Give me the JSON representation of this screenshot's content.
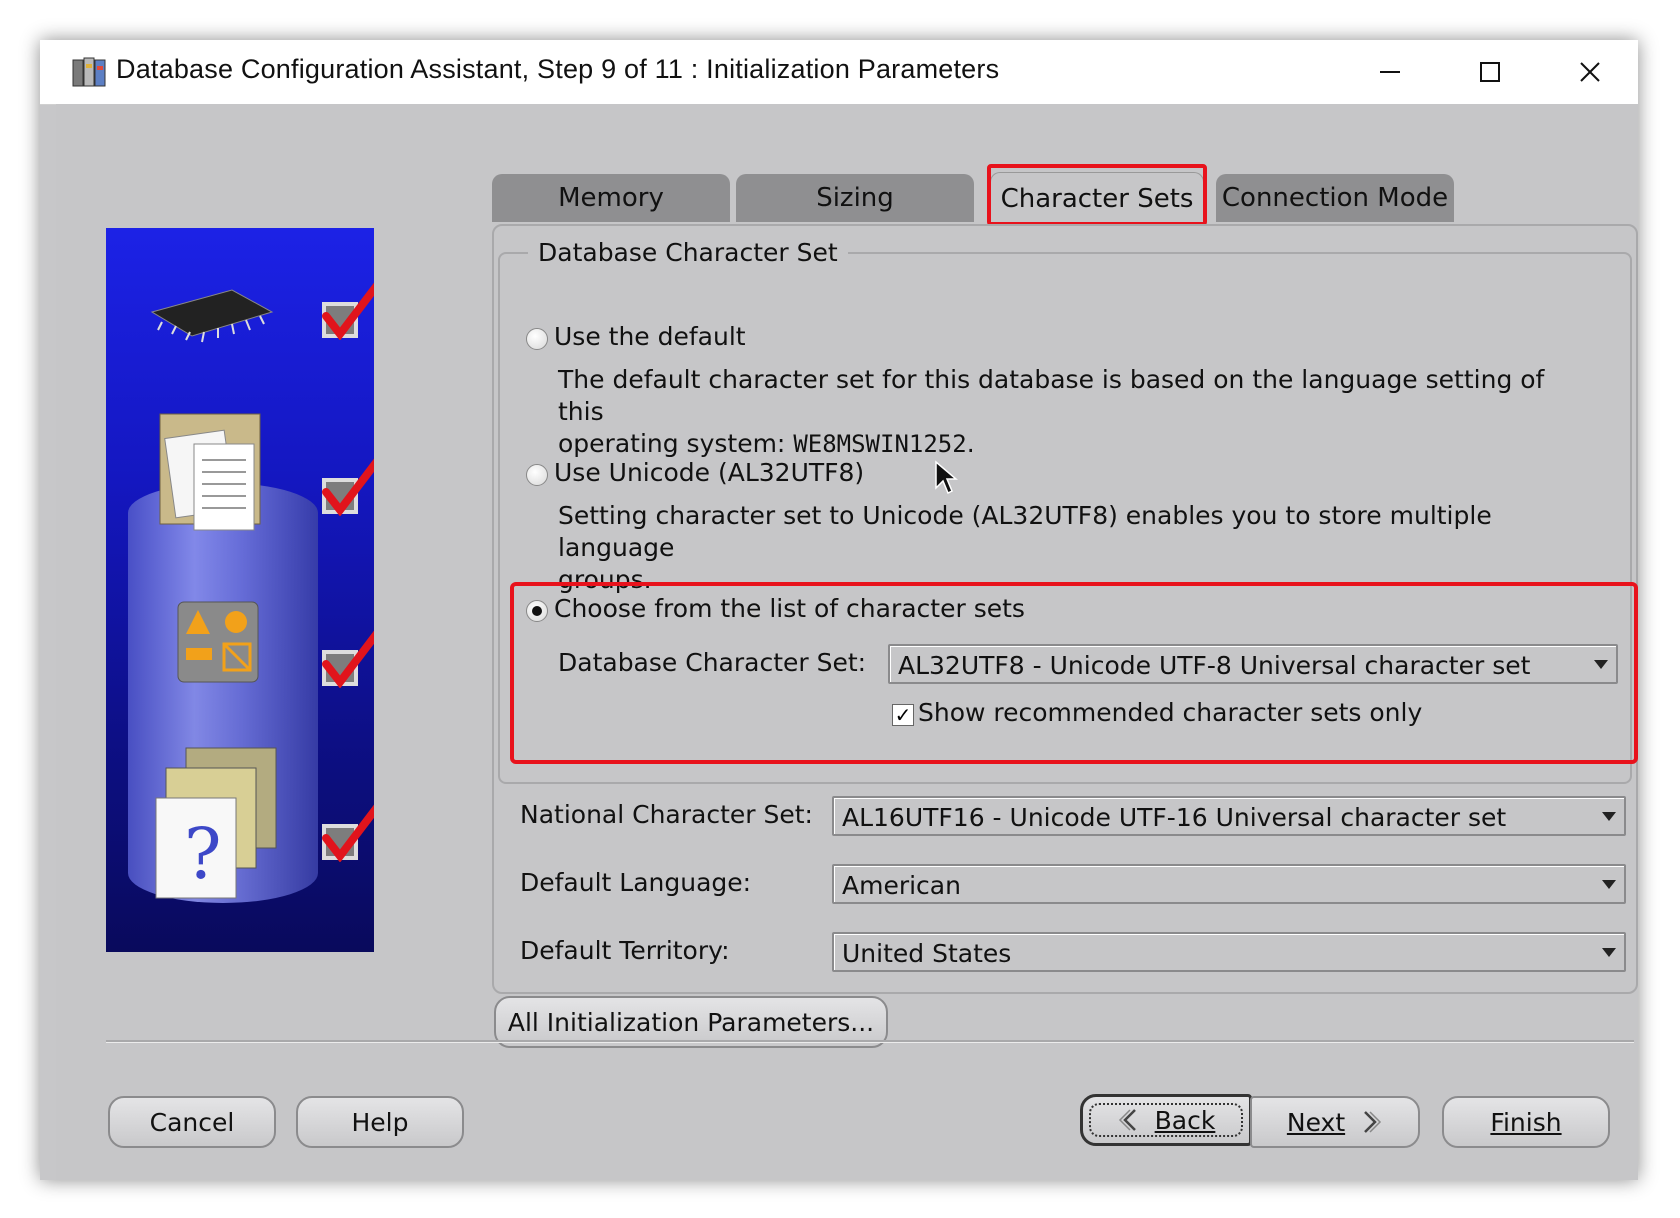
{
  "window": {
    "title": "Database Configuration Assistant, Step 9 of 11 : Initialization Parameters",
    "minimize_icon": "minimize-icon",
    "maximize_icon": "maximize-icon",
    "close_icon": "close-icon"
  },
  "tabs": [
    {
      "label": "Memory"
    },
    {
      "label": "Sizing"
    },
    {
      "label": "Character Sets",
      "active": true
    },
    {
      "label": "Connection Mode"
    }
  ],
  "db_charset_group": {
    "legend": "Database Character Set",
    "option_default": {
      "label": "Use the default",
      "desc_1": "The default character set for this database is based on the language setting of this",
      "desc_2": "operating system: ",
      "desc_value": "WE8MSWIN1252",
      "desc_end": "."
    },
    "option_unicode": {
      "label": "Use Unicode (AL32UTF8)",
      "desc_1": "Setting character set to Unicode (AL32UTF8) enables you to store multiple language",
      "desc_2": "groups."
    },
    "option_choose": {
      "label": "Choose from the list of character sets",
      "selected": true,
      "field_label": "Database Character Set:",
      "field_value": "AL32UTF8 - Unicode UTF-8 Universal character set",
      "checkbox_label": "Show recommended character sets only",
      "checkbox_checked": true
    }
  },
  "national_charset": {
    "label": "National Character Set:",
    "value": "AL16UTF16 - Unicode UTF-16 Universal character set"
  },
  "default_language": {
    "label": "Default Language:",
    "value": "American"
  },
  "default_territory": {
    "label": "Default Territory:",
    "value": "United States"
  },
  "buttons": {
    "all_params": "All Initialization Parameters...",
    "cancel": "Cancel",
    "help": "Help",
    "back": "Back",
    "next": "Next",
    "finish": "Finish"
  },
  "colors": {
    "highlight": "#e8121c",
    "panel_blue": "#1417c0",
    "client_bg": "#c6c6c8"
  }
}
